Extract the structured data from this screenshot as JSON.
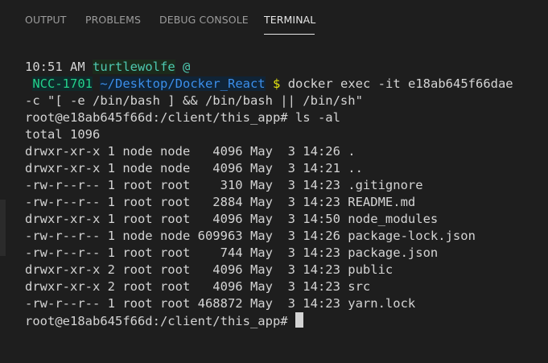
{
  "tabs": [
    "OUTPUT",
    "PROBLEMS",
    "DEBUG CONSOLE",
    "TERMINAL"
  ],
  "active_tab": "TERMINAL",
  "prompt": {
    "time": "10:51 AM",
    "user": "turtlewolfe",
    "at": "@",
    "host": "NCC-1701",
    "path": "~/Desktop/Docker_React",
    "dollar": "$",
    "command_line_1": "docker exec -it e18ab645f66dae",
    "command_line_2": "-c \"[ -e /bin/bash ] && /bin/bash || /bin/sh\""
  },
  "container_prompt": "root@e18ab645f66d:/client/this_app#",
  "ls_command": "ls -al",
  "total": "total 1096",
  "entries": [
    {
      "perms": "drwxr-xr-x",
      "links": "1",
      "owner": "node",
      "group": "node",
      "size": "4096",
      "month": "May",
      "day": "3",
      "time": "14:26",
      "name": "."
    },
    {
      "perms": "drwxr-xr-x",
      "links": "1",
      "owner": "node",
      "group": "node",
      "size": "4096",
      "month": "May",
      "day": "3",
      "time": "14:21",
      "name": ".."
    },
    {
      "perms": "-rw-r--r--",
      "links": "1",
      "owner": "root",
      "group": "root",
      "size": "310",
      "month": "May",
      "day": "3",
      "time": "14:23",
      "name": ".gitignore"
    },
    {
      "perms": "-rw-r--r--",
      "links": "1",
      "owner": "root",
      "group": "root",
      "size": "2884",
      "month": "May",
      "day": "3",
      "time": "14:23",
      "name": "README.md"
    },
    {
      "perms": "drwxr-xr-x",
      "links": "1",
      "owner": "root",
      "group": "root",
      "size": "4096",
      "month": "May",
      "day": "3",
      "time": "14:50",
      "name": "node_modules"
    },
    {
      "perms": "-rw-r--r--",
      "links": "1",
      "owner": "node",
      "group": "node",
      "size": "609963",
      "month": "May",
      "day": "3",
      "time": "14:26",
      "name": "package-lock.json"
    },
    {
      "perms": "-rw-r--r--",
      "links": "1",
      "owner": "root",
      "group": "root",
      "size": "744",
      "month": "May",
      "day": "3",
      "time": "14:23",
      "name": "package.json"
    },
    {
      "perms": "drwxr-xr-x",
      "links": "2",
      "owner": "root",
      "group": "root",
      "size": "4096",
      "month": "May",
      "day": "3",
      "time": "14:23",
      "name": "public"
    },
    {
      "perms": "drwxr-xr-x",
      "links": "2",
      "owner": "root",
      "group": "root",
      "size": "4096",
      "month": "May",
      "day": "3",
      "time": "14:23",
      "name": "src"
    },
    {
      "perms": "-rw-r--r--",
      "links": "1",
      "owner": "root",
      "group": "root",
      "size": "468872",
      "month": "May",
      "day": "3",
      "time": "14:23",
      "name": "yarn.lock"
    }
  ],
  "colors": {
    "background": "#1e1e1e",
    "text": "#d4d4d4",
    "user": "#4ec9b0",
    "host": "#23d18b",
    "path": "#3b8eea",
    "dollar": "#e5e510",
    "active_tab": "#e7e7e7",
    "inactive_tab": "#9c9c9c"
  }
}
